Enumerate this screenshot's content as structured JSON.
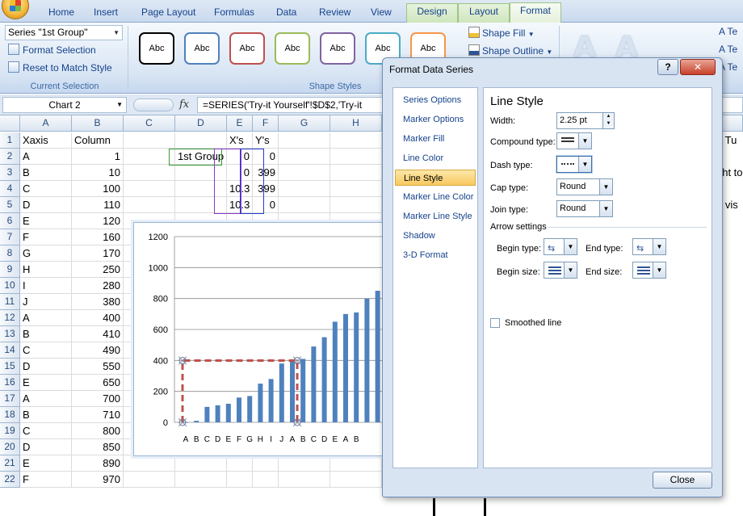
{
  "ribbon": {
    "tabs": [
      "Home",
      "Insert",
      "Page Layout",
      "Formulas",
      "Data",
      "Review",
      "View"
    ],
    "context_tabs": [
      "Design",
      "Layout",
      "Format"
    ],
    "active_tab": "Format",
    "current_selection": {
      "dropdown_value": "Series \"1st Group\"",
      "format_selection": "Format Selection",
      "reset_to_match_style": "Reset to Match Style",
      "group_label": "Current Selection"
    },
    "shape_styles": {
      "swatches": [
        {
          "label": "Abc",
          "color": "#000000"
        },
        {
          "label": "Abc",
          "color": "#4f81bd"
        },
        {
          "label": "Abc",
          "color": "#c0504d"
        },
        {
          "label": "Abc",
          "color": "#9bbb59"
        },
        {
          "label": "Abc",
          "color": "#8064a2"
        },
        {
          "label": "Abc",
          "color": "#4bacc6"
        },
        {
          "label": "Abc",
          "color": "#f79646"
        }
      ],
      "shape_fill": "Shape Fill",
      "shape_outline": "Shape Outline",
      "group_label": "Shape Styles"
    },
    "wordart_partial": [
      "Te",
      "Te",
      "Te"
    ]
  },
  "formula_bar": {
    "name_box": "Chart 2",
    "fx": "fx",
    "formula": "=SERIES('Try-it Yourself'!$D$2,'Try-it"
  },
  "grid": {
    "columns": [
      "A",
      "B",
      "C",
      "D",
      "E",
      "F",
      "G",
      "H"
    ],
    "rows": [
      {
        "n": "1",
        "A": "Xaxis",
        "B": "Column",
        "D": "",
        "E": "X's",
        "F": "Y's"
      },
      {
        "n": "2",
        "A": "A",
        "B": "1",
        "D": "1st Group",
        "E": "0",
        "F": "0"
      },
      {
        "n": "3",
        "A": "B",
        "B": "10",
        "D": "",
        "E": "0",
        "F": "399"
      },
      {
        "n": "4",
        "A": "C",
        "B": "100",
        "D": "",
        "E": "10.3",
        "F": "399"
      },
      {
        "n": "5",
        "A": "D",
        "B": "110",
        "D": "",
        "E": "10.3",
        "F": "0"
      },
      {
        "n": "6",
        "A": "E",
        "B": "120"
      },
      {
        "n": "7",
        "A": "F",
        "B": "160"
      },
      {
        "n": "8",
        "A": "G",
        "B": "170"
      },
      {
        "n": "9",
        "A": "H",
        "B": "250"
      },
      {
        "n": "10",
        "A": "I",
        "B": "280"
      },
      {
        "n": "11",
        "A": "J",
        "B": "380"
      },
      {
        "n": "12",
        "A": "A",
        "B": "400"
      },
      {
        "n": "13",
        "A": "B",
        "B": "410"
      },
      {
        "n": "14",
        "A": "C",
        "B": "490"
      },
      {
        "n": "15",
        "A": "D",
        "B": "550"
      },
      {
        "n": "16",
        "A": "E",
        "B": "650"
      },
      {
        "n": "17",
        "A": "A",
        "B": "700"
      },
      {
        "n": "18",
        "A": "B",
        "B": "710"
      },
      {
        "n": "19",
        "A": "C",
        "B": "800"
      },
      {
        "n": "20",
        "A": "D",
        "B": "850"
      },
      {
        "n": "21",
        "A": "E",
        "B": "890"
      },
      {
        "n": "22",
        "A": "F",
        "B": "970"
      }
    ],
    "side_text": [
      "e Tu",
      "ght to",
      "e vis"
    ]
  },
  "chart_data": {
    "type": "bar",
    "categories": [
      "A",
      "B",
      "C",
      "D",
      "E",
      "F",
      "G",
      "H",
      "I",
      "J",
      "A",
      "B",
      "C",
      "D",
      "E",
      "A",
      "B",
      "C",
      "D",
      "E",
      "F"
    ],
    "values": [
      1,
      10,
      100,
      110,
      120,
      160,
      170,
      250,
      280,
      380,
      400,
      410,
      490,
      550,
      650,
      700,
      710,
      800,
      850,
      890,
      970
    ],
    "visible_tick_labels": [
      "A",
      "B",
      "C",
      "D",
      "E",
      "F",
      "G",
      "H",
      "I",
      "J",
      "A",
      "B",
      "C",
      "D",
      "E",
      "A",
      "B"
    ],
    "yticks": [
      "0",
      "200",
      "400",
      "600",
      "800",
      "1000",
      "1200"
    ],
    "ylim": [
      0,
      1200
    ],
    "overlay_series": {
      "name": "1st Group",
      "x": [
        0,
        0,
        10.3,
        10.3
      ],
      "y": [
        0,
        399,
        399,
        0
      ],
      "color": "#c0504d",
      "dash": true
    },
    "bar_color": "#4f81bd"
  },
  "dialog": {
    "title": "Format Data Series",
    "help": "?",
    "close_x": "✕",
    "nav": [
      "Series Options",
      "Marker Options",
      "Marker Fill",
      "Line Color",
      "Line Style",
      "Marker Line Color",
      "Marker Line Style",
      "Shadow",
      "3-D Format"
    ],
    "active_nav": "Line Style",
    "pane": {
      "title": "Line Style",
      "width_label": "Width:",
      "width_value": "2.25 pt",
      "compound_label": "Compound type:",
      "dash_label": "Dash type:",
      "cap_label": "Cap type:",
      "cap_value": "Round",
      "join_label": "Join type:",
      "join_value": "Round",
      "arrow_settings": "Arrow settings",
      "begin_type": "Begin type:",
      "end_type": "End type:",
      "begin_size": "Begin size:",
      "end_size": "End size:",
      "smoothed": "Smoothed line"
    },
    "close_button": "Close"
  }
}
